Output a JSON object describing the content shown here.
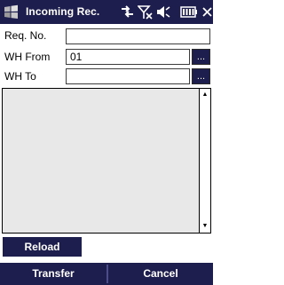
{
  "app": {
    "title": "Incoming Rec."
  },
  "status_icons": [
    "windows-start-icon",
    "connectivity-icon",
    "signal-off-icon",
    "volume-icon",
    "battery-icon"
  ],
  "form": {
    "req_no": {
      "label": "Req. No.",
      "value": ""
    },
    "wh_from": {
      "label": "WH From",
      "value": "01",
      "lookup_label": "..."
    },
    "wh_to": {
      "label": "WH To",
      "value": "",
      "lookup_label": "..."
    }
  },
  "list": {
    "items": []
  },
  "buttons": {
    "reload": "Reload",
    "transfer": "Transfer",
    "cancel": "Cancel"
  },
  "colors": {
    "bar": "#1d1e4d",
    "list_bg": "#e8e8e8",
    "text_on_bar": "#ffffff"
  }
}
